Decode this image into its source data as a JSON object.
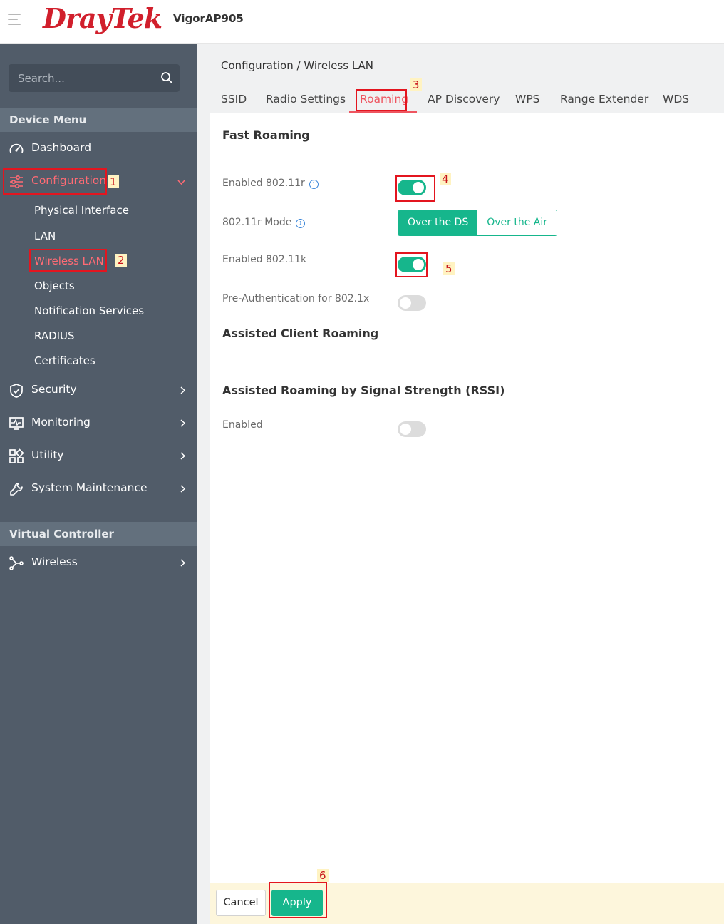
{
  "header": {
    "logo_text": "DrayTek",
    "model": "VigorAP905"
  },
  "sidebar": {
    "search_placeholder": "Search...",
    "device_menu_title": "Device Menu",
    "items": {
      "dashboard": "Dashboard",
      "configuration": "Configuration",
      "security": "Security",
      "monitoring": "Monitoring",
      "utility": "Utility",
      "system_maintenance": "System Maintenance"
    },
    "config_sub": [
      "Physical Interface",
      "LAN",
      "Wireless LAN",
      "Objects",
      "Notification Services",
      "RADIUS",
      "Certificates"
    ],
    "virtual_controller_title": "Virtual Controller",
    "wireless": "Wireless"
  },
  "main": {
    "breadcrumb": "Configuration / Wireless LAN",
    "tabs": [
      "SSID",
      "Radio Settings",
      "Roaming",
      "AP Discovery",
      "WPS",
      "Range Extender",
      "WDS"
    ],
    "active_tab": "Roaming",
    "fast_roaming": {
      "title": "Fast Roaming",
      "enabled_80211r_label": "Enabled 802.11r",
      "enabled_80211r": true,
      "mode_label": "802.11r Mode",
      "mode_options": [
        "Over the DS",
        "Over the Air"
      ],
      "mode_selected": "Over the DS",
      "enabled_80211k_label": "Enabled 802.11k",
      "enabled_80211k": true,
      "preauth_label": "Pre-Authentication for 802.1x",
      "preauth": false
    },
    "assisted_client_roaming": {
      "title": "Assisted Client Roaming"
    },
    "assisted_rssi": {
      "title": "Assisted Roaming by Signal Strength (RSSI)",
      "enabled_label": "Enabled",
      "enabled": false
    },
    "footer": {
      "cancel_label": "Cancel",
      "apply_label": "Apply"
    }
  },
  "callouts": [
    "1",
    "2",
    "3",
    "4",
    "5",
    "6"
  ],
  "colors": {
    "brand_red": "#d11f2c",
    "accent_green": "#16b68c",
    "sidebar_bg": "#515c69",
    "active_red": "#ee5560",
    "callout_red": "#e3151f"
  }
}
